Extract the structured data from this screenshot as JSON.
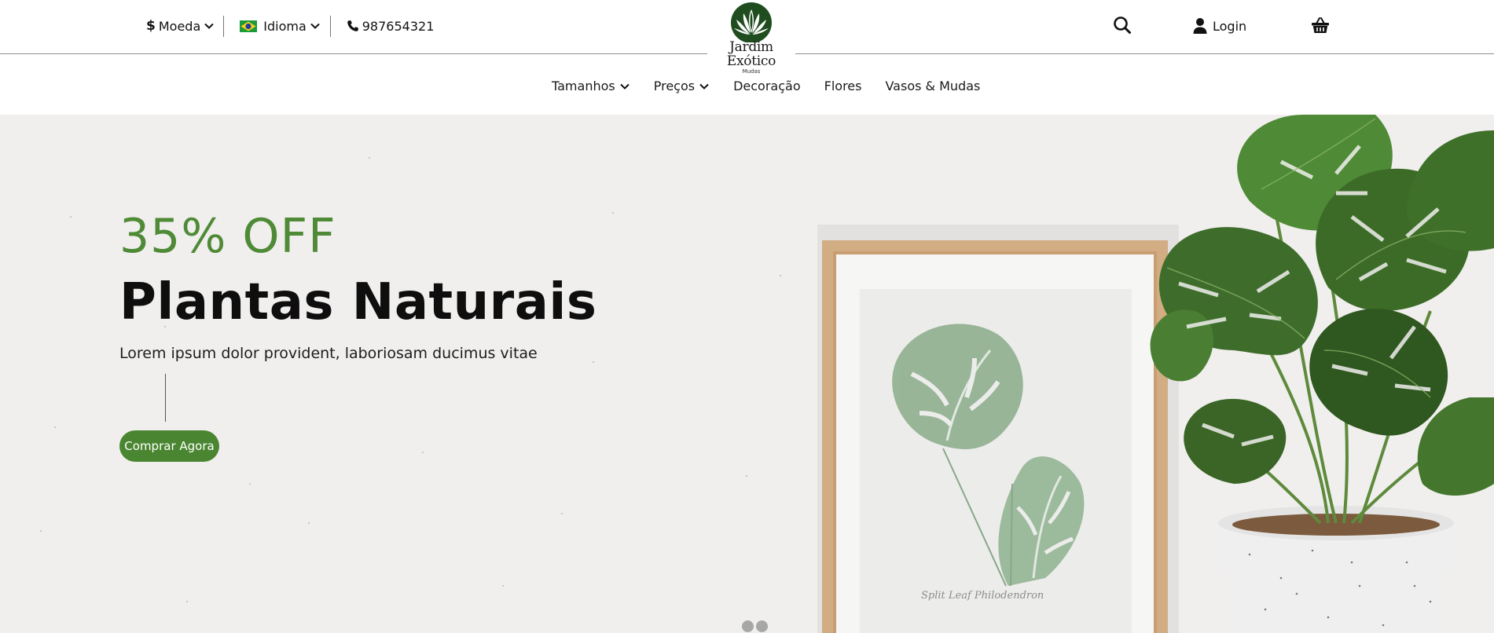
{
  "topbar": {
    "currency_label": "Moeda",
    "currency_symbol": "$",
    "language_label": "Idioma",
    "phone": "987654321",
    "login_label": "Login"
  },
  "brand": {
    "name": "Jardim Exótico",
    "sub": "Mudas",
    "color": "#1f4d1f"
  },
  "nav": {
    "items": [
      {
        "label": "Tamanhos",
        "has_dropdown": true
      },
      {
        "label": "Preços",
        "has_dropdown": true
      },
      {
        "label": "Decoração",
        "has_dropdown": false
      },
      {
        "label": "Flores",
        "has_dropdown": false
      },
      {
        "label": "Vasos & Mudas",
        "has_dropdown": false
      }
    ]
  },
  "hero": {
    "promo": "35% OFF",
    "headline": "Plantas Naturais",
    "subline": "Lorem ipsum dolor provident, laboriosam ducimus vitae",
    "cta_label": "Comprar Agora",
    "frame_caption": "Split Leaf Philodendron",
    "accent_color": "#4a8631",
    "background_color": "#f0efed"
  },
  "carousel": {
    "slide_count": 2,
    "active_slide": 1
  }
}
